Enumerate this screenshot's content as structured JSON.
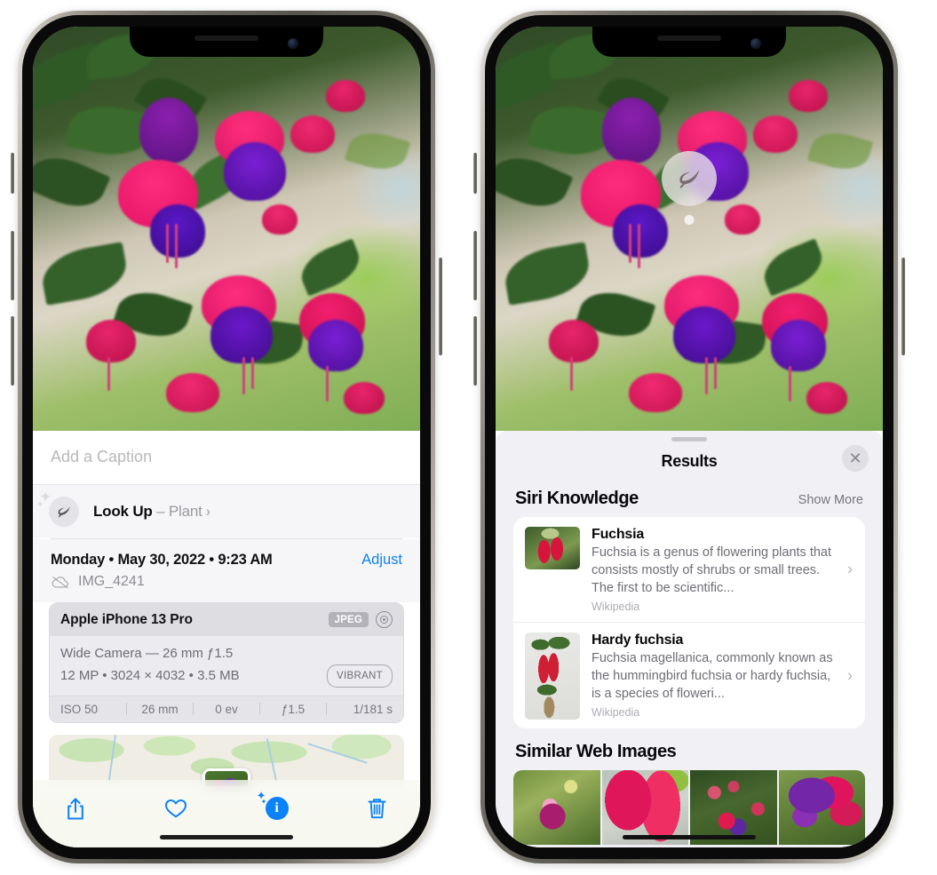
{
  "left_phone": {
    "caption_placeholder": "Add a Caption",
    "lookup": {
      "label": "Look Up",
      "dash": " – ",
      "subject": "Plant",
      "chevron": "›",
      "icon": "leaf-icon"
    },
    "date_text": "Monday • May 30, 2022 • 9:23 AM",
    "adjust_label": "Adjust",
    "file_name": "IMG_4241",
    "cloud_icon": "cloud-slash-icon",
    "camera": {
      "device": "Apple iPhone 13 Pro",
      "format_badge": "JPEG",
      "aperture_icon": "aperture-icon",
      "lens_line": "Wide Camera — 26 mm ƒ1.5",
      "spec_line": "12 MP • 3024 × 4032 • 3.5 MB",
      "style_badge": "VIBRANT",
      "exif": [
        "ISO 50",
        "26 mm",
        "0 ev",
        "ƒ1.5",
        "1/181 s"
      ]
    },
    "toolbar": {
      "share_label": "share-icon",
      "favorite_label": "heart-icon",
      "info_label": "info-icon",
      "info_glyph": "i",
      "delete_label": "trash-icon"
    }
  },
  "right_phone": {
    "visual_lookup_badge": "leaf-icon",
    "sheet": {
      "title": "Results",
      "close_label": "✕"
    },
    "siri_knowledge": {
      "title": "Siri Knowledge",
      "show_more": "Show More",
      "items": [
        {
          "name": "Fuchsia",
          "desc": "Fuchsia is a genus of flowering plants that consists mostly of shrubs or small trees. The first to be scientific...",
          "source": "Wikipedia",
          "chevron": "›"
        },
        {
          "name": "Hardy fuchsia",
          "desc": "Fuchsia magellanica, commonly known as the hummingbird fuchsia or hardy fuchsia, is a species of floweri...",
          "source": "Wikipedia",
          "chevron": "›"
        }
      ]
    },
    "similar_web_images": {
      "title": "Similar Web Images",
      "thumbs": [
        "web-image-1",
        "web-image-2",
        "web-image-3",
        "web-image-4"
      ]
    }
  },
  "colors": {
    "accent_blue": "#0b82f8",
    "sheet_bg": "#f1f1f5",
    "card_bg": "#ffffff",
    "muted_text": "#6e6d75",
    "frame": "#56534d"
  }
}
